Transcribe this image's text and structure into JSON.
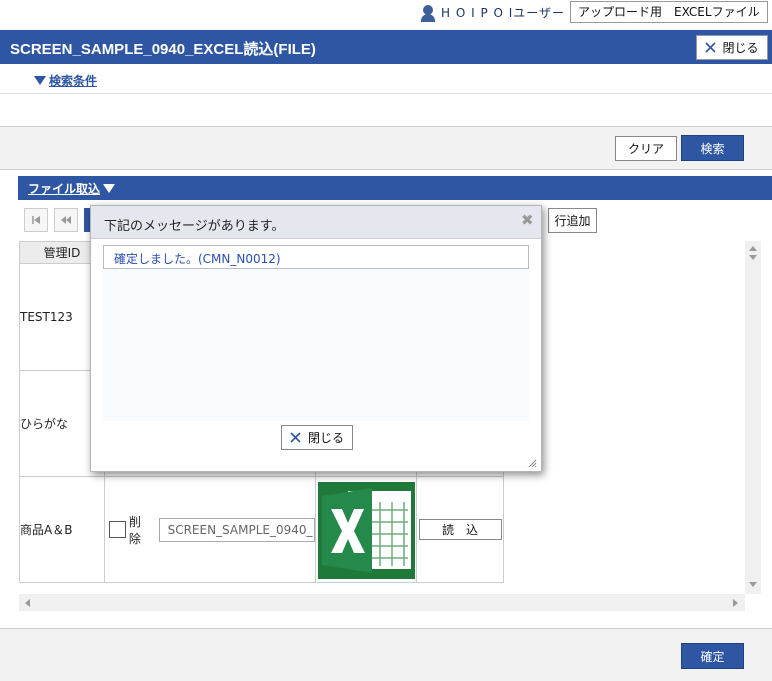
{
  "header": {
    "user_name": "H O I P O Iユーザー",
    "upload_label": "アップロード用　EXCELファイル",
    "title": "SCREEN_SAMPLE_0940_EXCEL読込(FILE)",
    "close_label": "閉じる"
  },
  "search": {
    "toggle_label": "検索条件",
    "clear_label": "クリア",
    "search_label": "検索"
  },
  "file_section": {
    "title": "ファイル取込",
    "pager": {
      "first_icon": "first-page-icon",
      "prev_icon": "prev-page-icon"
    },
    "add_row_label": "行追加",
    "columns": [
      "管理ID"
    ],
    "rows": [
      {
        "name": "TEST123"
      },
      {
        "name": "ひらがな"
      },
      {
        "name": "商品A＆B",
        "delete_label": "削除",
        "file_value": "SCREEN_SAMPLE_0940_",
        "read_label": "読　込",
        "icon": "excel-icon"
      }
    ]
  },
  "footer": {
    "confirm_label": "確定"
  },
  "dialog": {
    "title": "下記のメッセージがあります。",
    "message": "確定しました。(CMN_N0012)",
    "close_label": "閉じる"
  },
  "colors": {
    "primary": "#2f56a3",
    "message_text": "#2a4db0",
    "excel_green": "#1f7a3a"
  }
}
